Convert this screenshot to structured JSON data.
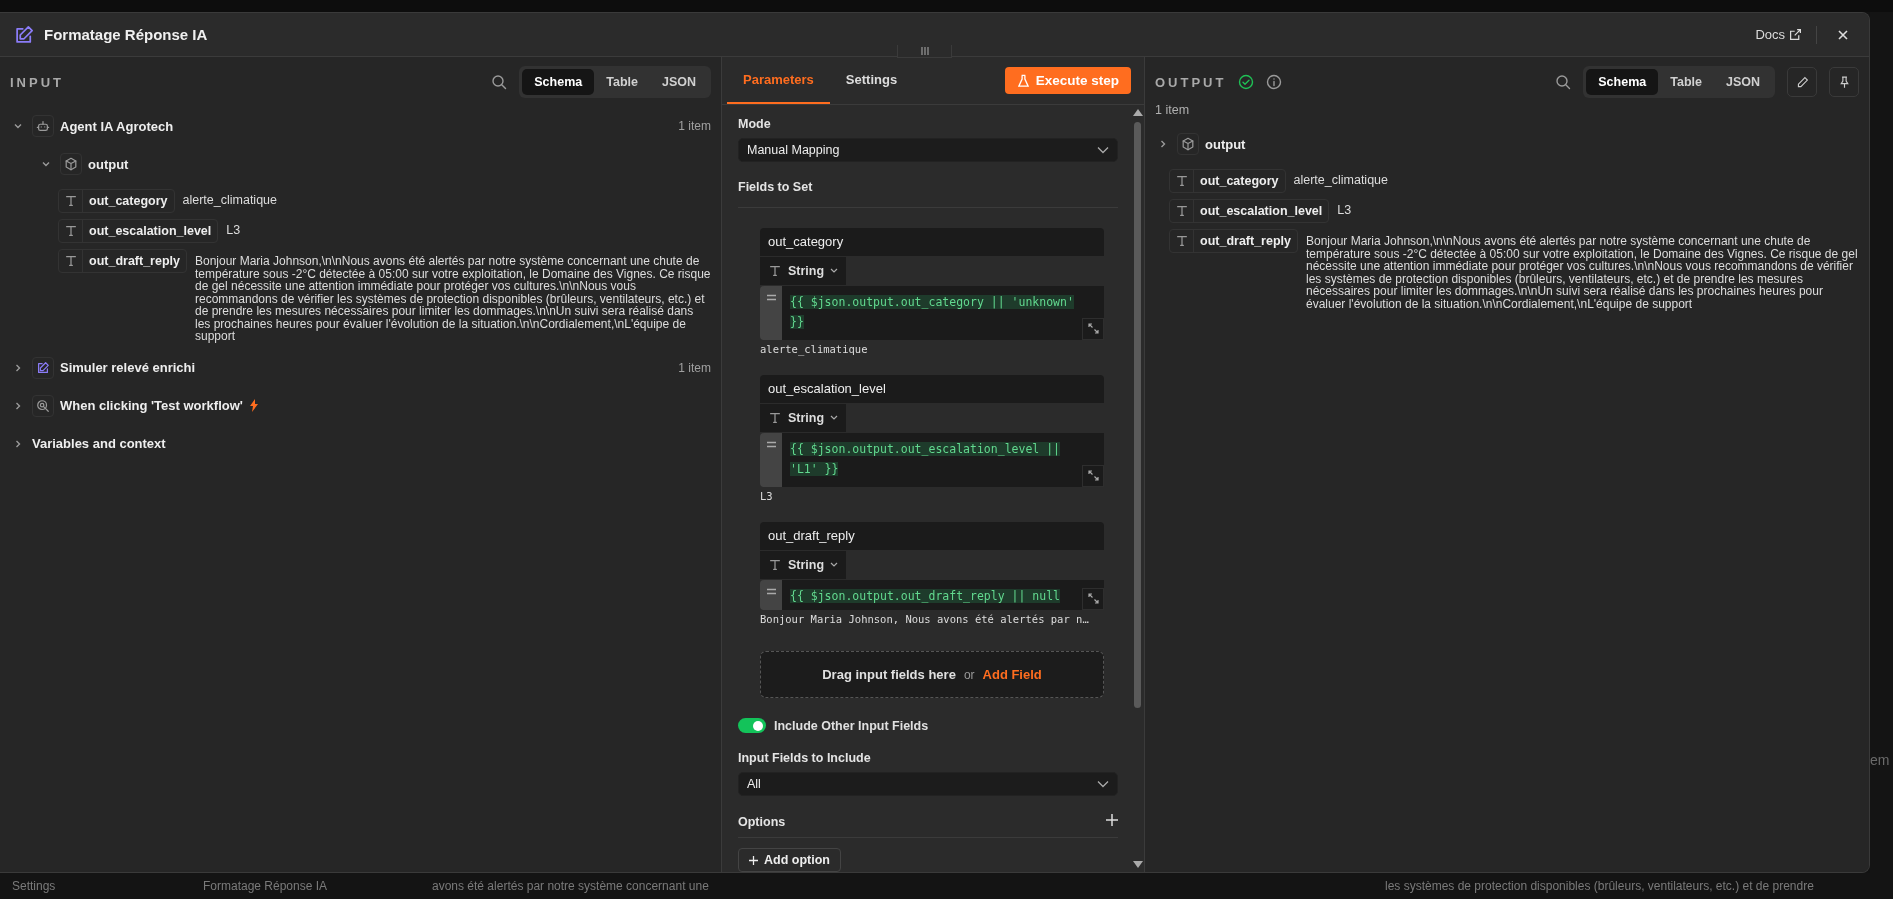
{
  "window": {
    "title": "Formatage Réponse IA",
    "docs": "Docs"
  },
  "input": {
    "title": "INPUT",
    "tabs": [
      {
        "label": "Schema",
        "selected": true
      },
      {
        "label": "Table",
        "selected": false
      },
      {
        "label": "JSON",
        "selected": false
      }
    ],
    "nodes": [
      {
        "kind": "agent",
        "name": "Agent IA Agrotech",
        "count": "1 item",
        "expanded": true,
        "children": [
          {
            "kind": "object",
            "name": "output",
            "expanded": true,
            "children": [
              {
                "kind": "string",
                "name": "out_category",
                "value": "alerte_climatique"
              },
              {
                "kind": "string",
                "name": "out_escalation_level",
                "value": "L3"
              },
              {
                "kind": "string",
                "name": "out_draft_reply",
                "value": "Bonjour Maria Johnson,\\n\\nNous avons été alertés par notre système concernant une chute de température sous -2°C détectée à 05:00 sur votre exploitation, le Domaine des Vignes. Ce risque de gel nécessite une attention immédiate pour protéger vos cultures.\\n\\nNous vous recommandons de vérifier les systèmes de protection disponibles (brûleurs, ventilateurs, etc.) et de prendre les mesures nécessaires pour limiter les dommages.\\n\\nUn suivi sera réalisé dans les prochaines heures pour évaluer l'évolution de la situation.\\n\\nCordialement,\\nL'équipe de support"
              }
            ]
          }
        ]
      },
      {
        "kind": "edit",
        "name": "Simuler relevé enrichi",
        "count": "1 item",
        "expanded": false
      },
      {
        "kind": "trigger",
        "name": "When clicking 'Test workflow'",
        "expanded": false
      },
      {
        "kind": "plain",
        "name": "Variables and context",
        "expanded": false
      }
    ]
  },
  "parameters": {
    "tabs": [
      {
        "label": "Parameters",
        "selected": true
      },
      {
        "label": "Settings",
        "selected": false
      }
    ],
    "execute": "Execute step",
    "mode": {
      "label": "Mode",
      "value": "Manual Mapping"
    },
    "fields_title": "Fields to Set",
    "fields": [
      {
        "name": "out_category",
        "type": "String",
        "expression": "{{ $json.output.out_category || 'unknown' }}",
        "preview": "alerte_climatique"
      },
      {
        "name": "out_escalation_level",
        "type": "String",
        "expression": "{{ $json.output.out_escalation_level || 'L1' }}",
        "preview": "L3"
      },
      {
        "name": "out_draft_reply",
        "type": "String",
        "expression": "{{ $json.output.out_draft_reply || null",
        "preview": "Bonjour Maria Johnson, Nous avons été alertés par n…",
        "cut": true
      }
    ],
    "drop": {
      "text": "Drag input fields here",
      "or": "or",
      "link": "Add Field"
    },
    "include_toggle": {
      "label": "Include Other Input Fields",
      "on": true
    },
    "include_select": {
      "label": "Input Fields to Include",
      "value": "All"
    },
    "options": {
      "label": "Options",
      "button": "Add option"
    }
  },
  "output": {
    "title": "OUTPUT",
    "tabs": [
      {
        "label": "Schema",
        "selected": true
      },
      {
        "label": "Table",
        "selected": false
      },
      {
        "label": "JSON",
        "selected": false
      }
    ],
    "count": "1 item",
    "items": [
      {
        "kind": "object",
        "name": "output",
        "expanded": false
      },
      {
        "kind": "string",
        "name": "out_category",
        "value": "alerte_climatique"
      },
      {
        "kind": "string",
        "name": "out_escalation_level",
        "value": "L3"
      },
      {
        "kind": "string",
        "name": "out_draft_reply",
        "value": "Bonjour Maria Johnson,\\n\\nNous avons été alertés par notre système concernant une chute de température sous -2°C détectée à 05:00 sur votre exploitation, le Domaine des Vignes. Ce risque de gel nécessite une attention immédiate pour protéger vos cultures.\\n\\nNous vous recommandons de vérifier les systèmes de protection disponibles (brûleurs, ventilateurs, etc.) et de prendre les mesures nécessaires pour limiter les dommages.\\n\\nUn suivi sera réalisé dans les prochaines heures pour évaluer l'évolution de la situation.\\n\\nCordialement,\\nL'équipe de support"
      }
    ]
  },
  "background": {
    "texts": [
      "Settings",
      "Formatage Réponse IA",
      "avons été alertés par notre système concernant une",
      "les systèmes de protection disponibles (brûleurs, ventilateurs, etc.) et de prendre"
    ],
    "side_text": "em"
  }
}
